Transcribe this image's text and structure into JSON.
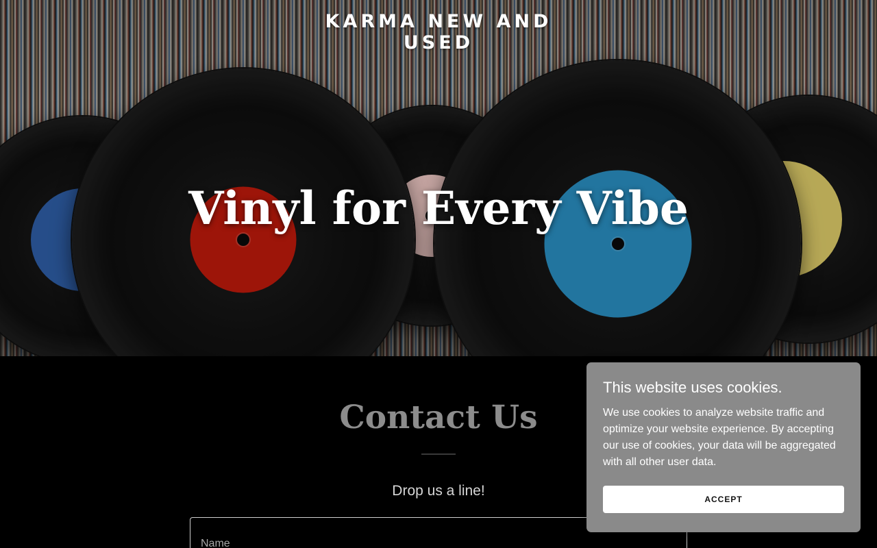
{
  "header": {
    "brand": "KARMA NEW AND USED"
  },
  "hero": {
    "title": "Vinyl for Every Vibe",
    "record_label_colors": [
      "#2f5fa8",
      "#c01a0c",
      "#efc8c4",
      "#2a8fc2",
      "#e0ce6a"
    ]
  },
  "contact": {
    "title": "Contact Us",
    "subtitle": "Drop us a line!",
    "name_placeholder": "Name"
  },
  "cookie_banner": {
    "title": "This website uses cookies.",
    "text": "We use cookies to analyze website traffic and optimize your website experience. By accepting our use of cookies, your data will be aggregated with all other user data.",
    "accept_label": "ACCEPT"
  }
}
